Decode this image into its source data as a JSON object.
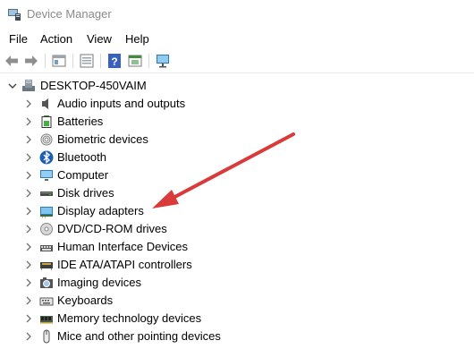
{
  "window": {
    "title": "Device Manager"
  },
  "menu": {
    "file": "File",
    "action": "Action",
    "view": "View",
    "help": "Help"
  },
  "toolbar": {
    "icons": [
      "back-arrow-icon",
      "forward-arrow-icon",
      "properties-icon",
      "list-view-icon",
      "help-icon",
      "console-tree-icon",
      "monitor-scan-icon"
    ]
  },
  "tree": {
    "root": {
      "label": "DESKTOP-450VAIM",
      "expanded": true,
      "icon": "computer-tower-icon"
    },
    "items": [
      {
        "label": "Audio inputs and outputs",
        "icon": "speaker-icon"
      },
      {
        "label": "Batteries",
        "icon": "battery-icon"
      },
      {
        "label": "Biometric devices",
        "icon": "fingerprint-icon"
      },
      {
        "label": "Bluetooth",
        "icon": "bluetooth-icon"
      },
      {
        "label": "Computer",
        "icon": "computer-monitor-icon"
      },
      {
        "label": "Disk drives",
        "icon": "disk-drive-icon"
      },
      {
        "label": "Display adapters",
        "icon": "display-adapter-icon"
      },
      {
        "label": "DVD/CD-ROM drives",
        "icon": "optical-drive-icon"
      },
      {
        "label": "Human Interface Devices",
        "icon": "hid-icon"
      },
      {
        "label": "IDE ATA/ATAPI controllers",
        "icon": "ide-controller-icon"
      },
      {
        "label": "Imaging devices",
        "icon": "camera-icon"
      },
      {
        "label": "Keyboards",
        "icon": "keyboard-icon"
      },
      {
        "label": "Memory technology devices",
        "icon": "memory-device-icon"
      },
      {
        "label": "Mice and other pointing devices",
        "icon": "mouse-icon"
      }
    ]
  },
  "colors": {
    "annotation_arrow": "#d93a3a",
    "title_text": "#8a8a8a",
    "chevron": "#707070"
  }
}
